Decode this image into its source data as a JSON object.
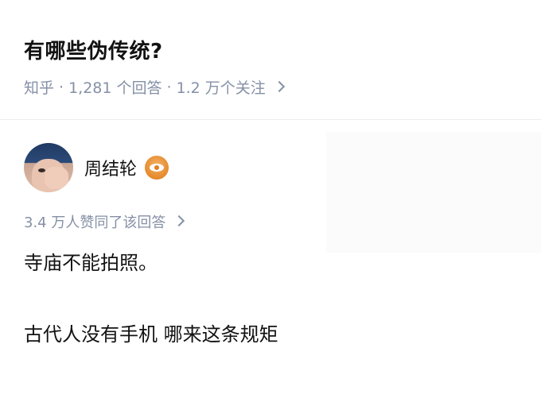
{
  "question": {
    "title": "有哪些伪传统?",
    "source": "知乎",
    "separator": "·",
    "answer_count": "1,281 个回答",
    "follower_count": "1.2 万个关注"
  },
  "answer": {
    "author_name": "周结轮",
    "badge_icon": "eye-badge-icon",
    "badge_color": "#e58a2b",
    "vote_summary": "3.4 万人赞同了该回答",
    "paragraphs": [
      "寺庙不能拍照。",
      "古代人没有手机 哪来这条规矩"
    ]
  },
  "colors": {
    "text_primary": "#121212",
    "text_secondary": "#8590a6",
    "divider": "#ececec"
  }
}
